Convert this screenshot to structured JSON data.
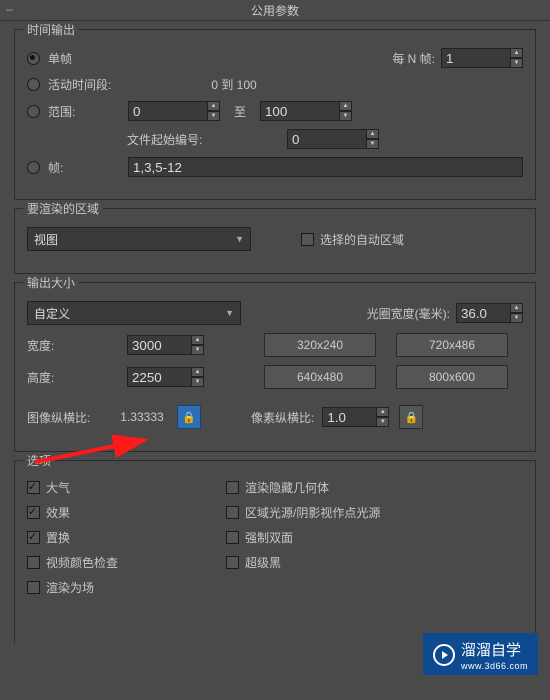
{
  "title": "公用参数",
  "time_output": {
    "group_label": "时间输出",
    "single_frame": "单帧",
    "every_n_label": "每 N 帧:",
    "every_n_value": "1",
    "active_segment": "活动时间段:",
    "active_range_text": "0 到 100",
    "range_label": "范围:",
    "range_from": "0",
    "range_to_label": "至",
    "range_to": "100",
    "file_start_label": "文件起始编号:",
    "file_start_value": "0",
    "frames_label": "帧:",
    "frames_value": "1,3,5-12"
  },
  "render_area": {
    "group_label": "要渲染的区域",
    "select_value": "视图",
    "auto_region": "选择的自动区域"
  },
  "output_size": {
    "group_label": "输出大小",
    "preset_select": "自定义",
    "aperture_label": "光圈宽度(毫米):",
    "aperture_value": "36.0",
    "width_label": "宽度:",
    "width_value": "3000",
    "height_label": "高度:",
    "height_value": "2250",
    "presets": [
      "320x240",
      "720x486",
      "640x480",
      "800x600"
    ],
    "image_aspect_label": "图像纵横比:",
    "image_aspect_value": "1.33333",
    "pixel_aspect_label": "像素纵横比:",
    "pixel_aspect_value": "1.0"
  },
  "options": {
    "group_label": "选项",
    "atmosphere": "大气",
    "render_hidden": "渲染隐藏几何体",
    "effects": "效果",
    "area_shadow": "区域光源/阴影视作点光源",
    "displacement": "置换",
    "force_2side": "强制双面",
    "video_color": "视频颜色检查",
    "super_black": "超级黑",
    "render_field": "渲染为场"
  },
  "watermark": {
    "brand": "溜溜自学",
    "url": "www.3d66.com"
  }
}
